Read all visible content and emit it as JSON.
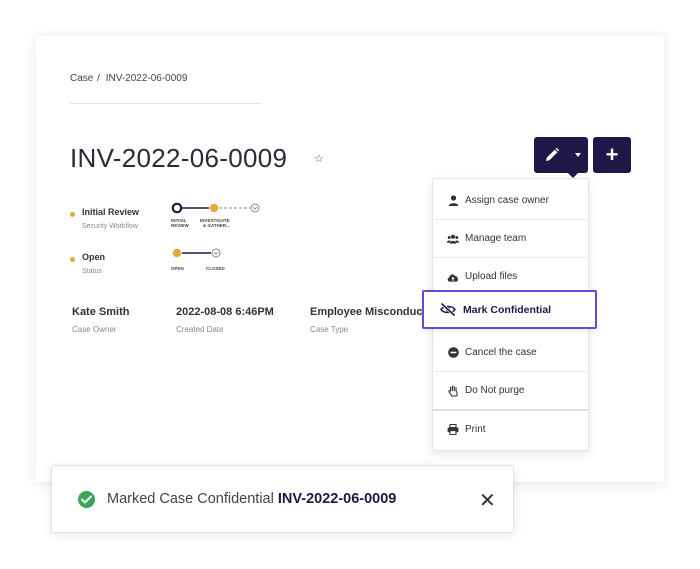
{
  "breadcrumb": {
    "root": "Case",
    "separator": "/",
    "current": "INV-2022-06-0009"
  },
  "case": {
    "title": "INV-2022-06-0009"
  },
  "workflow": {
    "name": "Initial Review",
    "sub": "Security Workflow",
    "stage_1_line1": "INITIAL",
    "stage_1_line2": "REVIEW",
    "stage_2_line1": "INVESTIGATE",
    "stage_2_line2": "& GATHER..."
  },
  "status": {
    "name": "Open",
    "sub": "Status",
    "stage_1": "OPEN",
    "stage_2": "CLOSED"
  },
  "meta": {
    "owner_value": "Kate Smith",
    "owner_label": "Case Owner",
    "created_value": "2022-08-08 6:46PM",
    "created_label": "Created Date",
    "type_value": "Employee Misconduct",
    "type_label": "Case Type"
  },
  "buttons": {
    "add_label": "+"
  },
  "menu": {
    "assign": "Assign case owner",
    "team": "Manage team",
    "upload": "Upload files",
    "confidential": "Mark Confidential",
    "cancel": "Cancel the case",
    "purge": "Do Not purge",
    "print": "Print"
  },
  "toast": {
    "message": "Marked Case Confidential",
    "case_id": "INV-2022-06-0009",
    "close": "✕"
  },
  "colors": {
    "brand": "#1f1848",
    "accent": "#5b4fd6",
    "warning": "#e6a93a",
    "success": "#3aa757"
  },
  "icons": [
    "star-icon",
    "pencil-icon",
    "caret-down-icon",
    "plus-icon",
    "user-icon",
    "users-icon",
    "cloud-upload-icon",
    "eye-slash-icon",
    "minus-circle-icon",
    "hand-icon",
    "printer-icon",
    "check-circle-icon",
    "close-icon"
  ]
}
